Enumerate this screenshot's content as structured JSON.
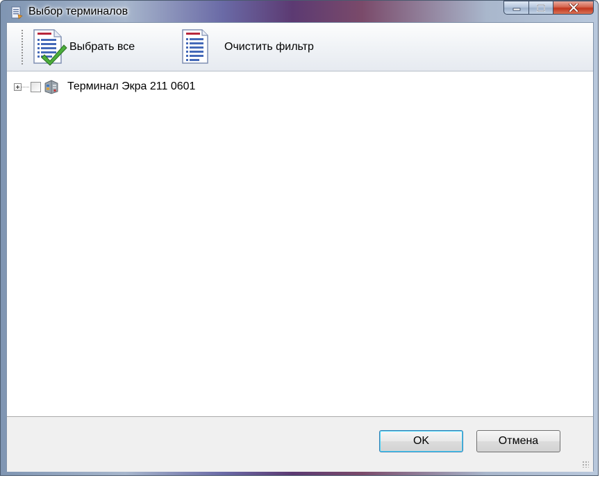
{
  "window": {
    "title": "Выбор терминалов",
    "caption_buttons": {
      "minimize": "minimize-icon",
      "maximize": "maximize-icon",
      "close": "close-icon"
    }
  },
  "toolbar": {
    "select_all_label": "Выбрать все",
    "select_all_icon": "checked-list-icon",
    "clear_filter_label": "Очистить фильтр",
    "clear_filter_icon": "list-icon"
  },
  "tree": {
    "nodes": [
      {
        "label": "Терминал Экра 211 0601",
        "expanded": false,
        "checked": false,
        "icon": "terminal-icon"
      }
    ]
  },
  "footer": {
    "ok_label": "OK",
    "cancel_label": "Отмена"
  },
  "colors": {
    "ok_border": "#3c7fb1",
    "close_button": "#c2361e"
  }
}
